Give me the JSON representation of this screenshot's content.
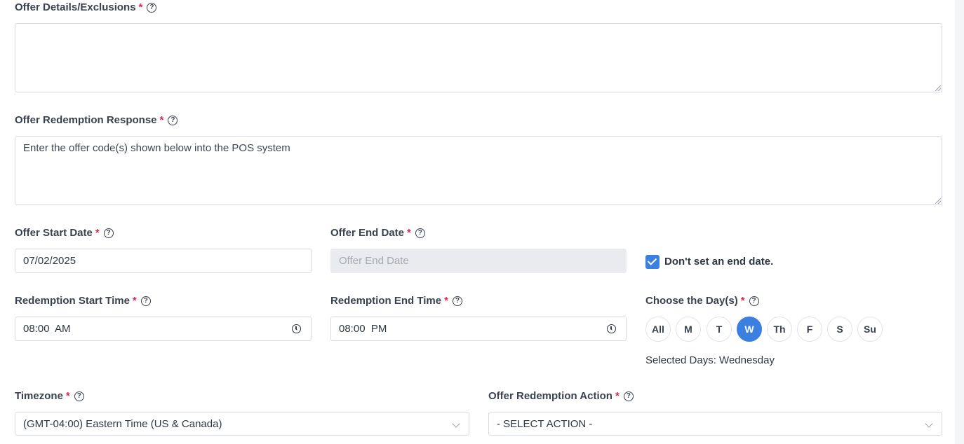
{
  "offer_details": {
    "label": "Offer Details/Exclusions",
    "value": ""
  },
  "redemption_response": {
    "label": "Offer Redemption Response",
    "value": "Enter the offer code(s) shown below into the POS system"
  },
  "start_date": {
    "label": "Offer Start Date",
    "value": "07/02/2025"
  },
  "end_date": {
    "label": "Offer End Date",
    "placeholder": "Offer End Date"
  },
  "no_end_date": {
    "label": "Don't set an end date.",
    "checked": true
  },
  "start_time": {
    "label": "Redemption Start Time",
    "value": "08:00  AM"
  },
  "end_time": {
    "label": "Redemption End Time",
    "value": "08:00  PM"
  },
  "days": {
    "label": "Choose the Day(s)",
    "options": [
      "All",
      "M",
      "T",
      "W",
      "Th",
      "F",
      "S",
      "Su"
    ],
    "selected": "W",
    "summary": "Selected Days: Wednesday"
  },
  "timezone": {
    "label": "Timezone",
    "value": "(GMT-04:00) Eastern Time (US & Canada)"
  },
  "redemption_action": {
    "label": "Offer Redemption Action",
    "value": "- SELECT ACTION -"
  },
  "required_mark": "*",
  "help_glyph": "?",
  "colors": {
    "accent": "#3b7fe0",
    "required": "#e0254a",
    "disabled_bg": "#e9ebee"
  }
}
